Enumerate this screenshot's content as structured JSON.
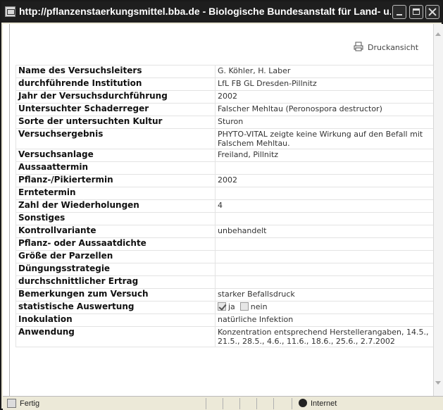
{
  "window": {
    "title": "http://pflanzenstaerkungsmittel.bba.de - Biologische Bundesanstalt für Land- u..."
  },
  "toolbar": {
    "print_label": "Druckansicht"
  },
  "table": [
    {
      "label": "Name des Versuchsleiters",
      "value": "G. Köhler, H. Laber"
    },
    {
      "label": "durchführende Institution",
      "value": "LfL FB GL Dresden-Pillnitz"
    },
    {
      "label": "Jahr der Versuchsdurchführung",
      "value": "2002"
    },
    {
      "label": "Untersuchter Schaderreger",
      "value": "Falscher Mehltau (Peronospora destructor)"
    },
    {
      "label": "Sorte der untersuchten Kultur",
      "value": "Sturon"
    },
    {
      "label": "Versuchsergebnis",
      "value": "PHYTO-VITAL zeigte keine Wirkung auf den Befall mit Falschem Mehltau."
    },
    {
      "label": "Versuchsanlage",
      "value": "Freiland, Pillnitz"
    },
    {
      "label": "Aussaattermin",
      "value": ""
    },
    {
      "label": "Pflanz-/Pikiertermin",
      "value": "2002"
    },
    {
      "label": "Erntetermin",
      "value": ""
    },
    {
      "label": "Zahl der Wiederholungen",
      "value": "4"
    },
    {
      "label": "Sonstiges",
      "value": ""
    },
    {
      "label": "Kontrollvariante",
      "value": "unbehandelt"
    },
    {
      "label": "Pflanz- oder Aussaatdichte",
      "value": ""
    },
    {
      "label": "Größe der Parzellen",
      "value": ""
    },
    {
      "label": "Düngungsstrategie",
      "value": ""
    },
    {
      "label": "durchschnittlicher Ertrag",
      "value": ""
    },
    {
      "label": "Bemerkungen zum Versuch",
      "value": "starker Befallsdruck"
    }
  ],
  "stat_row": {
    "label": "statistische Auswertung",
    "yes_label": "ja",
    "no_label": "nein",
    "yes_checked": true,
    "no_checked": false
  },
  "table_tail": [
    {
      "label": "Inokulation",
      "value": "natürliche Infektion"
    },
    {
      "label": "Anwendung",
      "value": "Konzentration entsprechend Herstellerangaben, 14.5., 21.5., 28.5., 4.6., 11.6., 18.6., 25.6., 2.7.2002"
    }
  ],
  "status": {
    "text": "Fertig",
    "zone": "Internet"
  },
  "icons": {
    "page": "page-icon",
    "printer": "printer-icon",
    "globe": "globe-icon"
  }
}
